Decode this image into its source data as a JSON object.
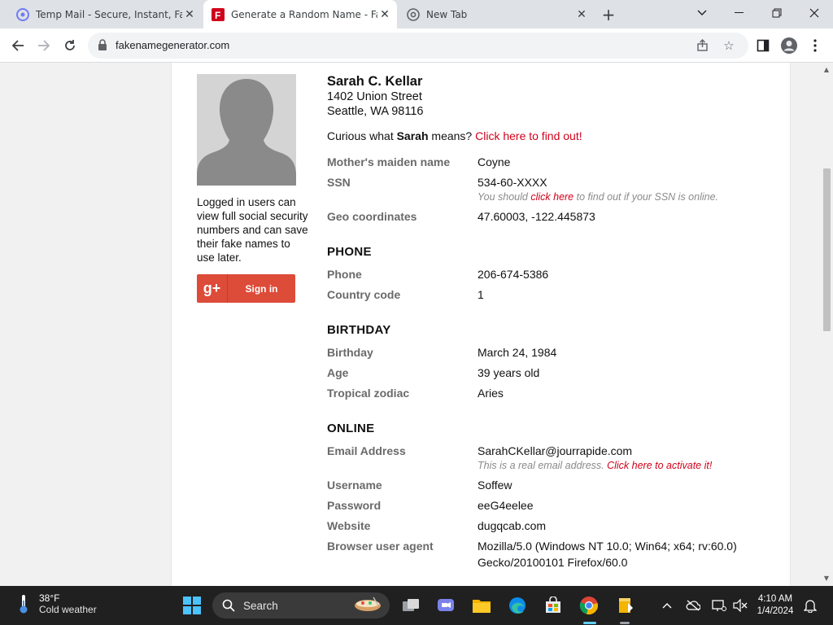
{
  "browser": {
    "tabs": [
      {
        "title": "Temp Mail - Secure, Instant, Fast",
        "active": false
      },
      {
        "title": "Generate a Random Name - Fake",
        "active": true
      },
      {
        "title": "New Tab",
        "active": false
      }
    ],
    "url": "fakenamegenerator.com"
  },
  "sidebar": {
    "login_note": "Logged in users can view full social security numbers and can save their fake names to use later.",
    "gplus_logo": "g+",
    "signin_label": "Sign in"
  },
  "identity": {
    "name": "Sarah C. Kellar",
    "street": "1402 Union Street",
    "city_line": "Seattle, WA 98116",
    "curious_prefix": "Curious what ",
    "curious_name": "Sarah",
    "curious_suffix": " means? ",
    "curious_link": "Click here to find out!"
  },
  "fields": {
    "maiden_label": "Mother's maiden name",
    "maiden_value": "Coyne",
    "ssn_label": "SSN",
    "ssn_value": "534-60-XXXX",
    "ssn_note_prefix": "You should ",
    "ssn_note_link": "click here",
    "ssn_note_suffix": " to find out if your SSN is online.",
    "geo_label": "Geo coordinates",
    "geo_value": "47.60003, -122.445873"
  },
  "phone": {
    "heading": "PHONE",
    "phone_label": "Phone",
    "phone_value": "206-674-5386",
    "cc_label": "Country code",
    "cc_value": "1"
  },
  "birthday": {
    "heading": "BIRTHDAY",
    "birthday_label": "Birthday",
    "birthday_value": "March 24, 1984",
    "age_label": "Age",
    "age_value": "39 years old",
    "zodiac_label": "Tropical zodiac",
    "zodiac_value": "Aries"
  },
  "online": {
    "heading": "ONLINE",
    "email_label": "Email Address",
    "email_value": "SarahCKellar@jourrapide.com",
    "email_note_prefix": "This is a real email address. ",
    "email_note_link": "Click here to activate it!",
    "username_label": "Username",
    "username_value": "Soffew",
    "password_label": "Password",
    "password_value": "eeG4eelee",
    "website_label": "Website",
    "website_value": "dugqcab.com",
    "ua_label": "Browser user agent",
    "ua_line1": "Mozilla/5.0 (Windows NT 10.0; Win64; x64; rv:60.0)",
    "ua_line2": "Gecko/20100101 Firefox/60.0"
  },
  "taskbar": {
    "weather_temp": "38°F",
    "weather_desc": "Cold weather",
    "search_label": "Search",
    "time": "4:10 AM",
    "date": "1/4/2024"
  },
  "colors": {
    "accent_red": "#d0021b",
    "gplus_red": "#dd4b39"
  }
}
